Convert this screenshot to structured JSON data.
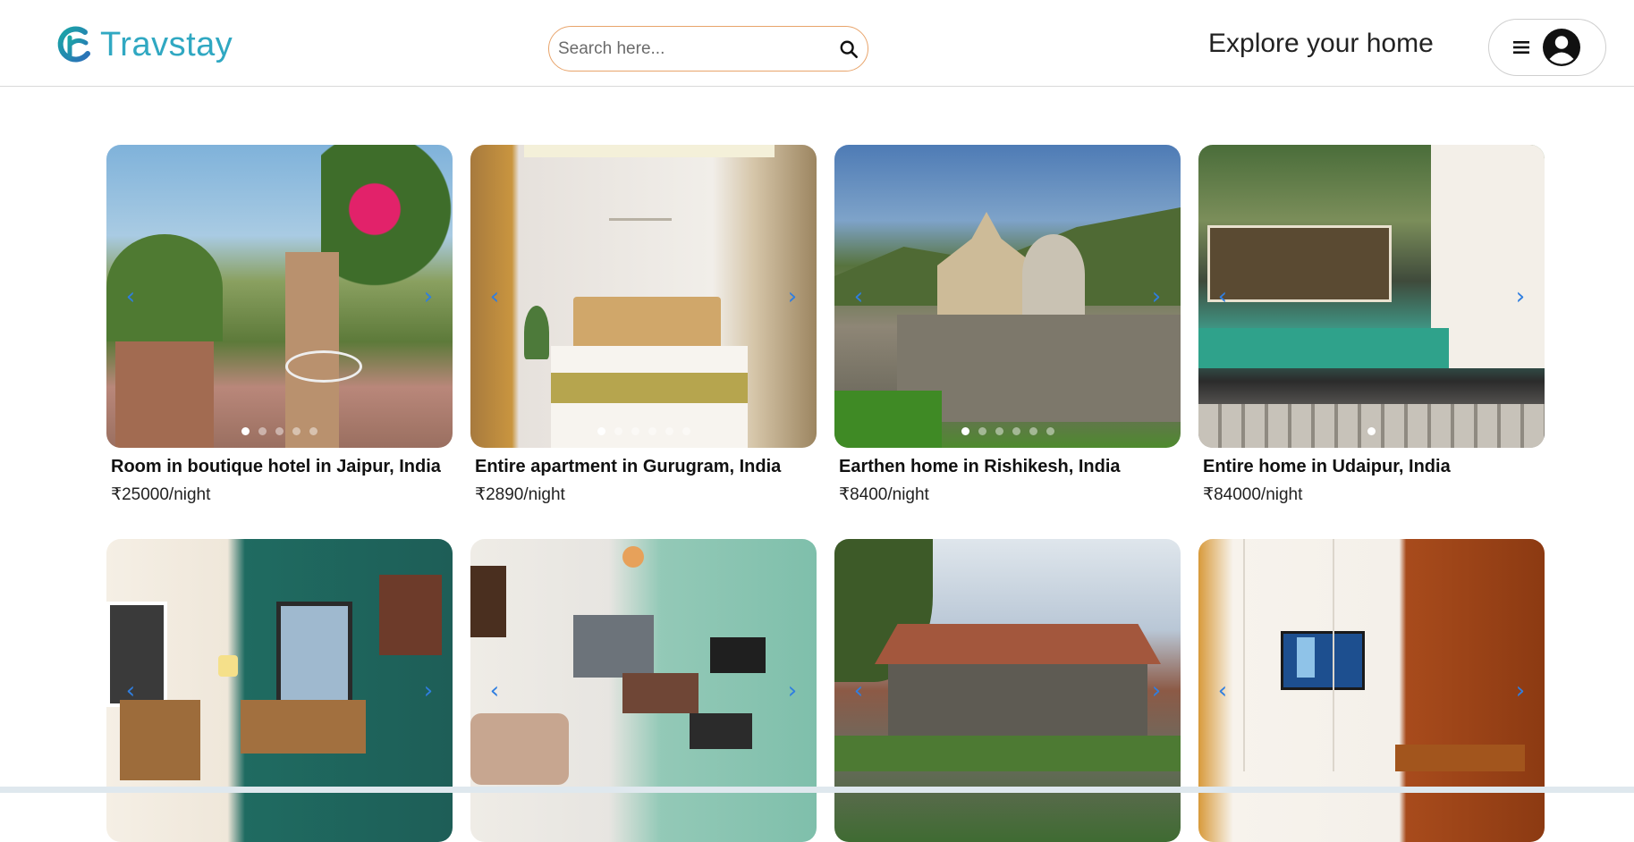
{
  "header": {
    "brand": "Travstay",
    "search_placeholder": "Search here...",
    "explore_link": "Explore your home"
  },
  "colors": {
    "brand": "#30a8c2",
    "search_border": "#e8a46b",
    "arrow": "#2f7ee0"
  },
  "icons": {
    "logo": "travstay-logo-icon",
    "search": "search-icon",
    "menu": "hamburger-menu-icon",
    "user": "user-avatar-icon",
    "prev": "chevron-left-icon",
    "next": "chevron-right-icon"
  },
  "listings": [
    {
      "title": "Room in boutique hotel in Jaipur, India",
      "price": "₹25000/night",
      "dots": 5,
      "active_dot": 0
    },
    {
      "title": "Entire apartment in Gurugram, India",
      "price": "₹2890/night",
      "dots": 6,
      "active_dot": 0
    },
    {
      "title": "Earthen home in Rishikesh, India",
      "price": "₹8400/night",
      "dots": 6,
      "active_dot": 0
    },
    {
      "title": "Entire home in Udaipur, India",
      "price": "₹84000/night",
      "dots": 1,
      "active_dot": 0
    },
    {
      "title": "",
      "price": "",
      "dots": 0,
      "active_dot": 0
    },
    {
      "title": "",
      "price": "",
      "dots": 0,
      "active_dot": 0
    },
    {
      "title": "",
      "price": "",
      "dots": 0,
      "active_dot": 0
    },
    {
      "title": "",
      "price": "",
      "dots": 0,
      "active_dot": 0
    }
  ]
}
